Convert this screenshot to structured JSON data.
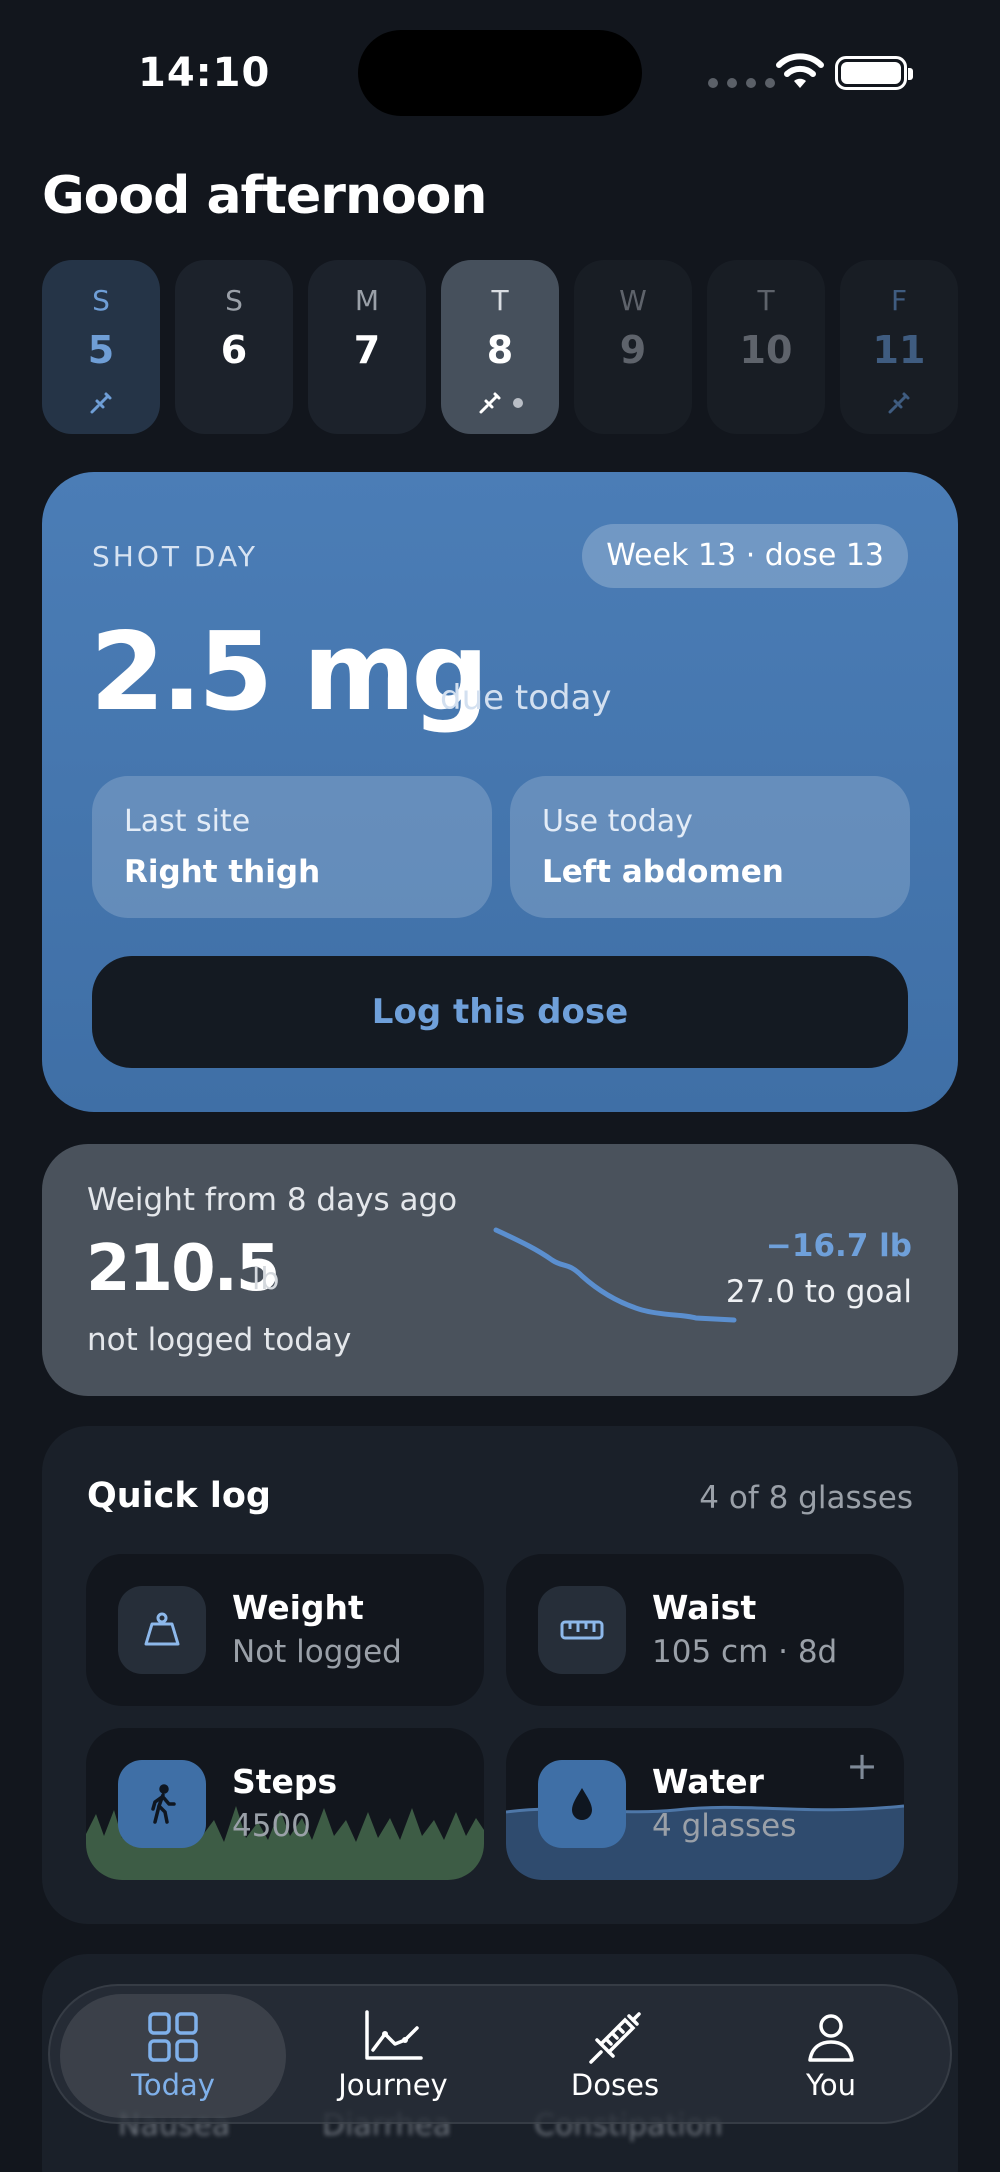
{
  "status": {
    "time": "14:10"
  },
  "greeting": "Good afternoon",
  "days": [
    {
      "letter": "S",
      "number": "5"
    },
    {
      "letter": "S",
      "number": "6"
    },
    {
      "letter": "M",
      "number": "7"
    },
    {
      "letter": "T",
      "number": "8"
    },
    {
      "letter": "W",
      "number": "9"
    },
    {
      "letter": "T",
      "number": "10"
    },
    {
      "letter": "F",
      "number": "11"
    }
  ],
  "shot": {
    "label": "SHOT DAY",
    "week_pill": "Week 13 · dose 13",
    "dose": "2.5 mg",
    "due": "due today",
    "last_site_label": "Last site",
    "last_site_value": "Right thigh",
    "use_today_label": "Use today",
    "use_today_value": "Left abdomen",
    "log_button": "Log this dose"
  },
  "weight": {
    "title": "Weight from 8 days ago",
    "value": "210.5",
    "unit": "lb",
    "subtitle": "not logged today",
    "delta": "−16.7 lb",
    "to_goal": "27.0 to goal"
  },
  "quick_log": {
    "title": "Quick log",
    "meta": "4 of 8 glasses",
    "tiles": [
      {
        "title": "Weight",
        "sub": "Not logged",
        "icon": "scale-icon"
      },
      {
        "title": "Waist",
        "sub": "105 cm · 8d",
        "icon": "ruler-icon"
      },
      {
        "title": "Steps",
        "sub": "4500",
        "icon": "walking-icon"
      },
      {
        "title": "Water",
        "sub": "4 glasses",
        "icon": "water-drop-icon"
      }
    ],
    "add": "+"
  },
  "symptoms": {
    "labels": [
      "Nausea",
      "Diarrhea",
      "Constipation"
    ]
  },
  "tabs": [
    {
      "label": "Today",
      "icon": "grid-icon"
    },
    {
      "label": "Journey",
      "icon": "chart-icon"
    },
    {
      "label": "Doses",
      "icon": "syringe-icon"
    },
    {
      "label": "You",
      "icon": "person-icon"
    }
  ],
  "colors": {
    "accent": "#6fa0da",
    "shot_card": "#4677b0",
    "background": "#12161d"
  }
}
